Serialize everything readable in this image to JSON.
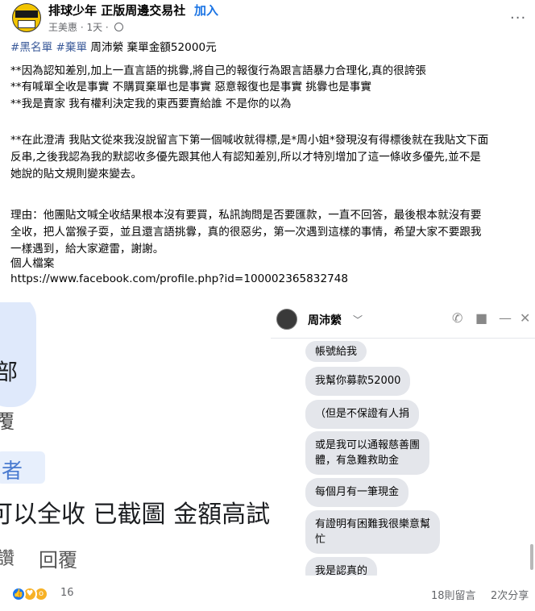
{
  "header": {
    "group_name": "排球少年 正版周邊交易社",
    "separator": "·",
    "join_label": "加入",
    "author": "王美惠",
    "time": "1天",
    "more_label": "···"
  },
  "post": {
    "tag1": "#黑名單",
    "tag2": "#棄單",
    "title_rest": "周沛縈 棄單金額52000元",
    "line1": "**因為認知差別,加上一直言語的挑釁,將自己的報復行為跟言語暴力合理化,真的很誇張",
    "line2": "**有喊單全收是事實 不購買棄單也是事實 惡意報復也是事實 挑釁也是事實",
    "line3": "**我是賣家 我有權利決定我的東西要賣給誰 不是你的以為",
    "clarify1": "**在此澄清 我貼文從來我沒說留言下第一個喊收就得標,是*周小姐*發現沒有得標後就在我貼文下面",
    "clarify2": "反串,之後我認為我的默認收多優先跟其他人有認知差別,所以才特別增加了這一條收多優先,並不是",
    "clarify3": "她說的貼文規則變來變去。",
    "reason1": "理由：他團貼文喊全收結果根本沒有要買，私訊詢問是否要匯款，一直不回答，最後根本就沒有要",
    "reason2": "全收，把人當猴子耍，並且還言語挑釁，真的很惡劣，第一次遇到這樣的事情，希望大家不要跟我",
    "reason3": "一樣遇到，給大家避雷，謝謝。",
    "profile_label": "個人檔案",
    "profile_url": "https://www.facebook.com/profile.php?id=100002365832748"
  },
  "screenshot_left": {
    "t1": "部",
    "t2": "覆",
    "t3": "者",
    "t4": "可以全收 已截圖 金額高試",
    "t5": "讚",
    "t6": "回覆"
  },
  "chat": {
    "name": "周沛縈",
    "messages": [
      "帳號給我",
      "我幫你募款52000",
      "（但是不保證有人捐",
      "或是我可以通報慈善團\n體，有急難救助金",
      "每個月有一筆現金",
      "有證明有困難我很樂意幫\n忙",
      "我是認真的"
    ]
  },
  "footer": {
    "reaction_count": "16",
    "comments": "18則留言",
    "shares": "2次分享"
  },
  "colors": {
    "link": "#385898",
    "join": "#1b74e4",
    "bubble": "#e4e6eb"
  }
}
